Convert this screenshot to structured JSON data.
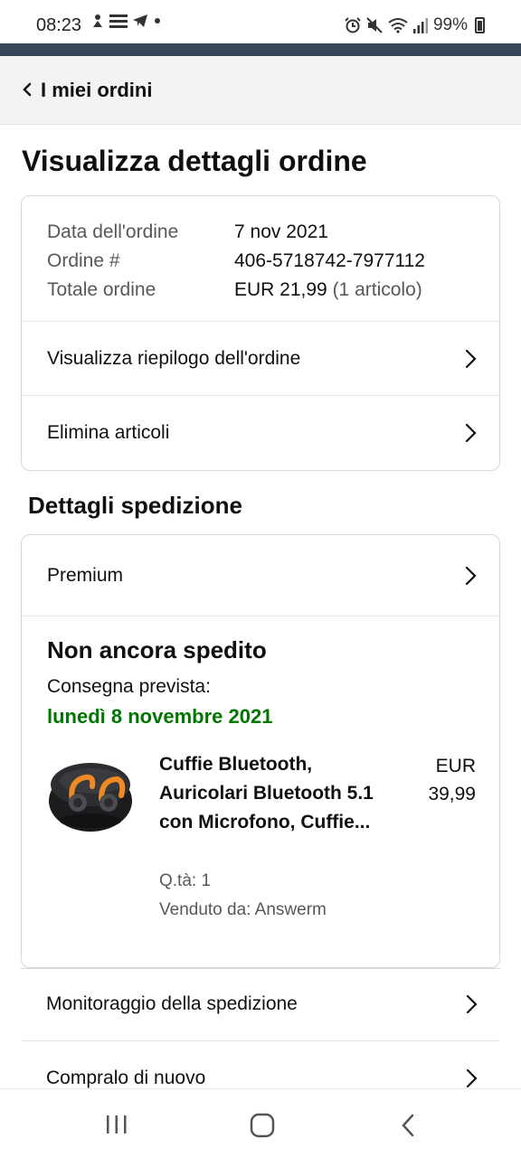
{
  "status_bar": {
    "time": "08:23",
    "battery": "99%"
  },
  "nav": {
    "back_label": "I miei ordini"
  },
  "page": {
    "title": "Visualizza dettagli ordine"
  },
  "order_info": {
    "rows": [
      {
        "label": "Data dell'ordine",
        "value": "7 nov 2021",
        "extra": ""
      },
      {
        "label": "Ordine #",
        "value": "406-5718742-7977112",
        "extra": ""
      },
      {
        "label": "Totale ordine",
        "value": "EUR 21,99",
        "extra": " (1 articolo)"
      }
    ],
    "links": [
      {
        "label": "Visualizza riepilogo dell'ordine"
      },
      {
        "label": "Elimina articoli"
      }
    ]
  },
  "shipping": {
    "section_title": "Dettagli spedizione",
    "method": "Premium",
    "status": "Non ancora spedito",
    "eta_label": "Consegna prevista:",
    "eta_date": "lunedì 8 novembre 2021",
    "product": {
      "title": "Cuffie Bluetooth, Auricolari Bluetooth 5.1 con Microfono, Cuffie...",
      "price_currency": "EUR",
      "price_amount": "39,99",
      "qty": "Q.tà: 1",
      "seller": "Venduto da: Answerm"
    }
  },
  "actions": {
    "track": "Monitoraggio della spedizione",
    "buy_again": "Compralo di nuovo"
  },
  "colors": {
    "header_strip": "#37475a",
    "eta_green": "#007600"
  }
}
